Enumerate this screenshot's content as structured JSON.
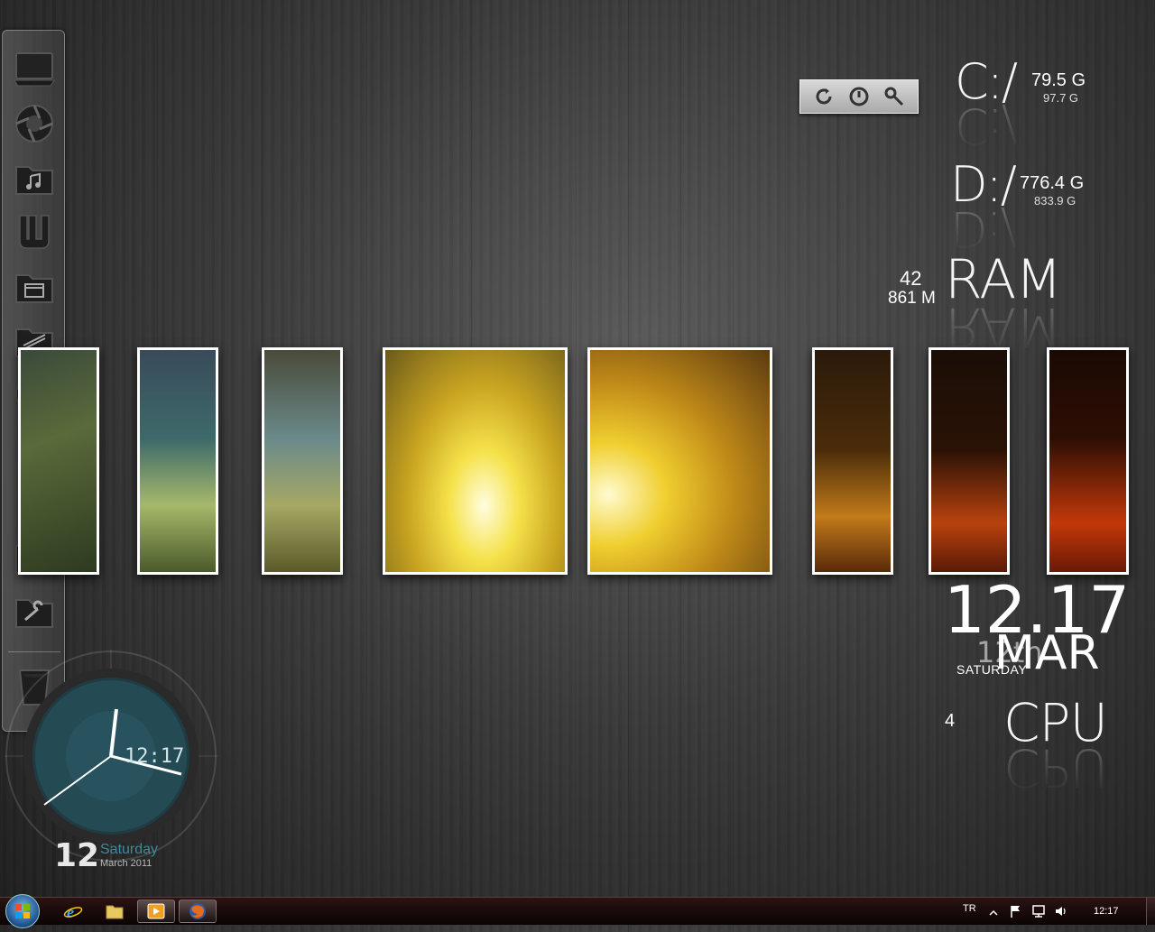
{
  "drives": [
    {
      "letter": "C:/",
      "free": "79.5 G",
      "total": "97.7 G"
    },
    {
      "letter": "D:/",
      "free": "776.4 G",
      "total": "833.9 G"
    }
  ],
  "ram": {
    "label": "RAM",
    "percent": "42",
    "used": "861 M"
  },
  "cpu": {
    "label": "CPU",
    "percent": "4"
  },
  "big_clock": {
    "time": "12.17",
    "day_num": "12th",
    "weekday": "SATURDAY",
    "month": "MAR"
  },
  "analog_clock": {
    "time": "12:17",
    "day": "12",
    "weekday": "Saturday",
    "month_year": "March 2011"
  },
  "taskbar": {
    "language": "TR",
    "time": "12:17"
  },
  "dock": {
    "items": [
      "computer-icon",
      "aperture-icon",
      "music-folder-icon",
      "utorrent-icon",
      "window-folder-icon",
      "documents-folder-icon",
      "firefox-icon",
      "vlc-icon",
      "speaker-icon",
      "download-folder-icon",
      "tools-folder-icon",
      "recycle-bin-icon"
    ]
  },
  "colors": {
    "accent_teal": "#3f8b99",
    "photo_border": "#ffffff",
    "taskbar_bg": "#1a0a0a"
  }
}
